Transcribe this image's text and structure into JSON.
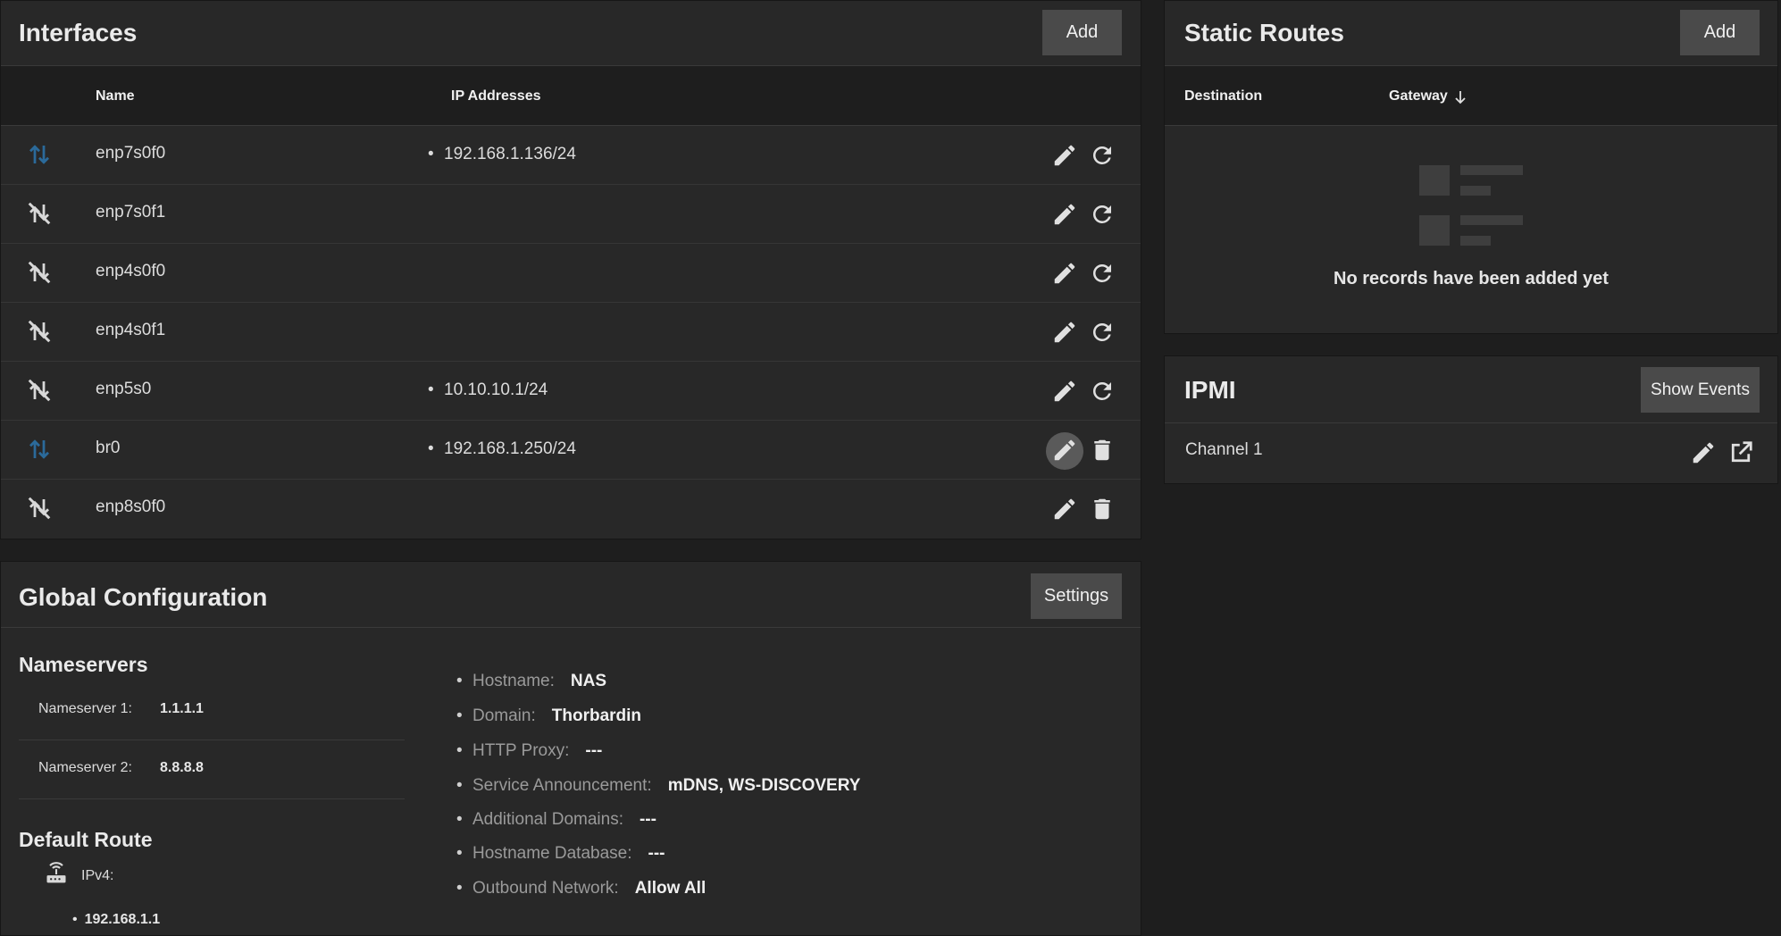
{
  "interfaces": {
    "title": "Interfaces",
    "add_label": "Add",
    "columns": {
      "name": "Name",
      "ip": "IP Addresses"
    },
    "rows": [
      {
        "name": "enp7s0f0",
        "ip": "192.168.1.136/24",
        "state": "up"
      },
      {
        "name": "enp7s0f1",
        "ip": "",
        "state": "down"
      },
      {
        "name": "enp4s0f0",
        "ip": "",
        "state": "down"
      },
      {
        "name": "enp4s0f1",
        "ip": "",
        "state": "down"
      },
      {
        "name": "enp5s0",
        "ip": "10.10.10.1/24",
        "state": "down"
      },
      {
        "name": "br0",
        "ip": "192.168.1.250/24",
        "state": "up"
      },
      {
        "name": "enp8s0f0",
        "ip": "",
        "state": "down"
      }
    ],
    "state_icons": {
      "up": "arrows-up-down-icon",
      "down": "network-off-icon"
    },
    "action_icons": [
      "pencil-icon",
      "refresh-icon",
      "trash-icon"
    ]
  },
  "static_routes": {
    "title": "Static Routes",
    "add_label": "Add",
    "columns": {
      "destination": "Destination",
      "gateway": "Gateway"
    },
    "empty_text": "No records have been added yet",
    "sort_icon": "arrow-down-icon"
  },
  "ipmi": {
    "title": "IPMI",
    "show_events_label": "Show Events",
    "channel": "Channel 1",
    "icons": [
      "pencil-icon",
      "open-external-icon"
    ]
  },
  "global_config": {
    "title": "Global Configuration",
    "settings_label": "Settings",
    "nameservers_heading": "Nameservers",
    "nameservers": [
      {
        "label": "Nameserver 1:",
        "value": "1.1.1.1"
      },
      {
        "label": "Nameserver 2:",
        "value": "8.8.8.8"
      }
    ],
    "default_route_heading": "Default Route",
    "ipv4_label": "IPv4:",
    "ipv4_value": "192.168.1.1",
    "router_icon": "router-icon",
    "details": [
      {
        "key": "Hostname:",
        "value": "NAS"
      },
      {
        "key": "Domain:",
        "value": "Thorbardin"
      },
      {
        "key": "HTTP Proxy:",
        "value": "---"
      },
      {
        "key": "Service Announcement:",
        "value": "mDNS, WS-DISCOVERY"
      },
      {
        "key": "Additional Domains:",
        "value": "---"
      },
      {
        "key": "Hostname Database:",
        "value": "---"
      },
      {
        "key": "Outbound Network:",
        "value": "Allow All"
      }
    ]
  },
  "colors": {
    "background": "#1e1e1e",
    "card": "#282828",
    "button": "#4a4a4a",
    "link_up": "#2b6a9a"
  }
}
